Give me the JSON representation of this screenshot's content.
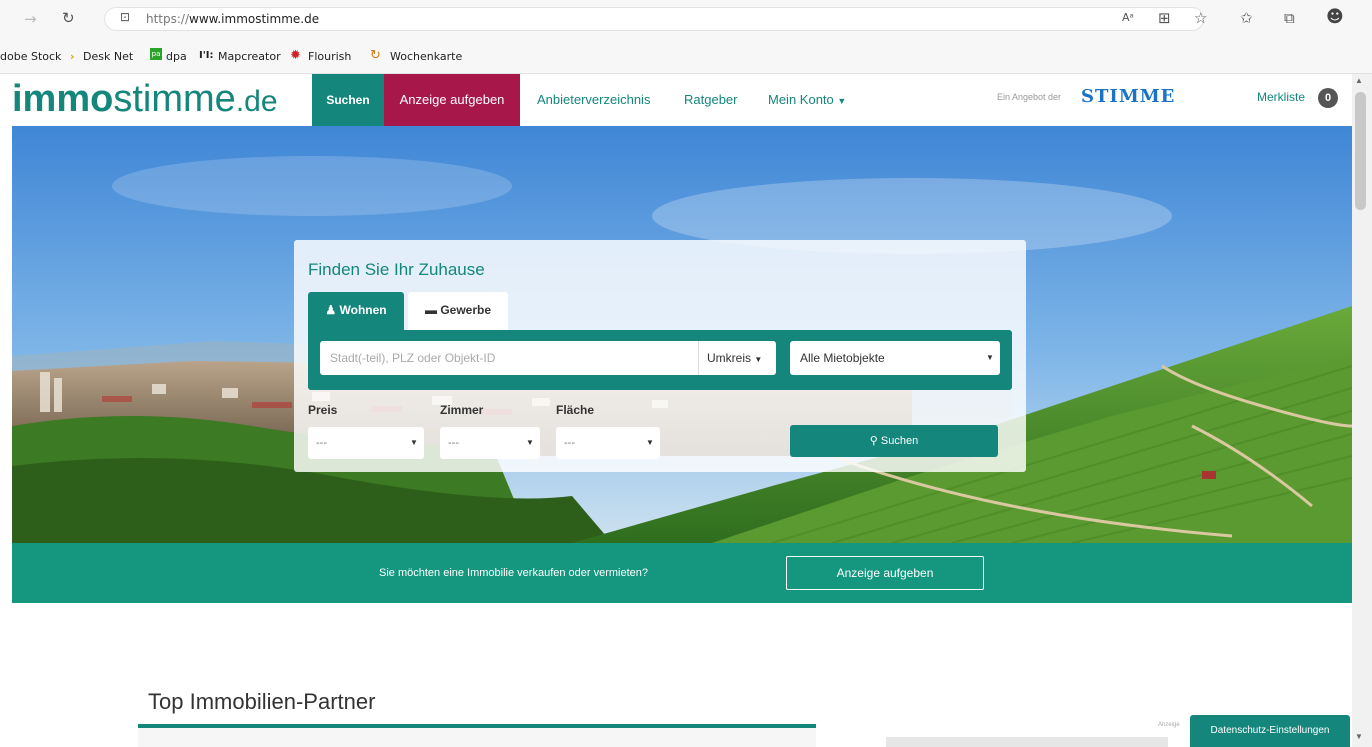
{
  "browser": {
    "url_protocol": "https://",
    "url_host": "www.immostimme.de",
    "bookmarks": [
      "dobe Stock",
      "Desk Net",
      "dpa",
      "Mapcreator",
      "Flourish",
      "Wochenkarte"
    ],
    "bookmark_badges": {
      "dpa": "pa",
      "mapcreator": "I'I:"
    },
    "read_aloud_label": "Aᵃ"
  },
  "header": {
    "logo_bold": "immo",
    "logo_light": "stimme",
    "logo_tld": ".de",
    "nav": {
      "suchen": "Suchen",
      "anzeige": "Anzeige aufgeben",
      "anbieter": "Anbieterverzeichnis",
      "ratgeber": "Ratgeber",
      "konto": "Mein Konto"
    },
    "angebot": "Ein Angebot der",
    "stimme": "STIMME",
    "merkliste": "Merkliste",
    "merkliste_count": "0"
  },
  "search": {
    "title": "Finden Sie Ihr Zuhause",
    "tab_wohnen": "Wohnen",
    "tab_gewerbe": "Gewerbe",
    "input_placeholder": "Stadt(-teil), PLZ oder Objekt-ID",
    "umkreis": "Umkreis",
    "objekte": "Alle Mietobjekte",
    "preis_label": "Preis",
    "zimmer_label": "Zimmer",
    "flaeche_label": "Fläche",
    "preis_value": "---",
    "zimmer_value": "---",
    "flaeche_value": "---",
    "button": "Suchen"
  },
  "cta": {
    "text": "Sie möchten eine Immobilie verkaufen oder vermieten?",
    "button": "Anzeige aufgeben"
  },
  "partners": {
    "title": "Top Immobilien-Partner",
    "anzeige_small": "Anzeige"
  },
  "cookie": {
    "label": "Datenschutz-Einstellungen"
  },
  "colors": {
    "teal": "#14867c",
    "banner_teal": "#14967f",
    "magenta": "#a8174a",
    "stimme_blue": "#1a73c4"
  }
}
